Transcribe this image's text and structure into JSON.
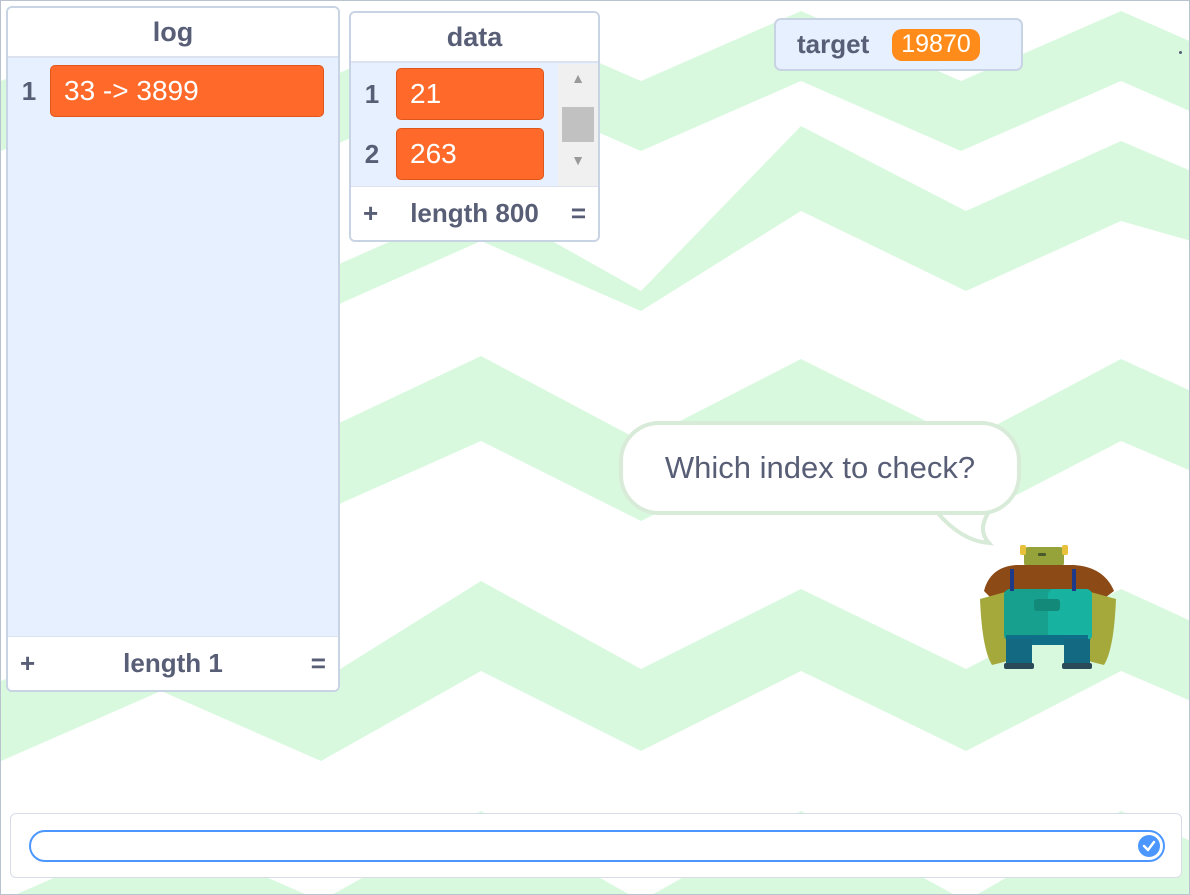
{
  "log_monitor": {
    "title": "log",
    "items": [
      {
        "index": "1",
        "value": "33 -> 3899"
      }
    ],
    "footer": {
      "add": "+",
      "length": "length 1",
      "resize": "="
    }
  },
  "data_monitor": {
    "title": "data",
    "items": [
      {
        "index": "1",
        "value": "21"
      },
      {
        "index": "2",
        "value": "263"
      }
    ],
    "footer": {
      "add": "+",
      "length": "length 800",
      "resize": "="
    }
  },
  "target_monitor": {
    "label": "target",
    "value": "19870"
  },
  "speech_bubble": {
    "text": "Which index to check?"
  },
  "ask_prompt": {
    "value": "",
    "submit_icon": "check-circle-icon"
  },
  "colors": {
    "list_item": "#ff6a2b",
    "variable_value": "#ff8c1a",
    "monitor_bg": "#e6f0ff",
    "backdrop_zigzag": "#d9f9df",
    "input_focus": "#4c97ff"
  }
}
